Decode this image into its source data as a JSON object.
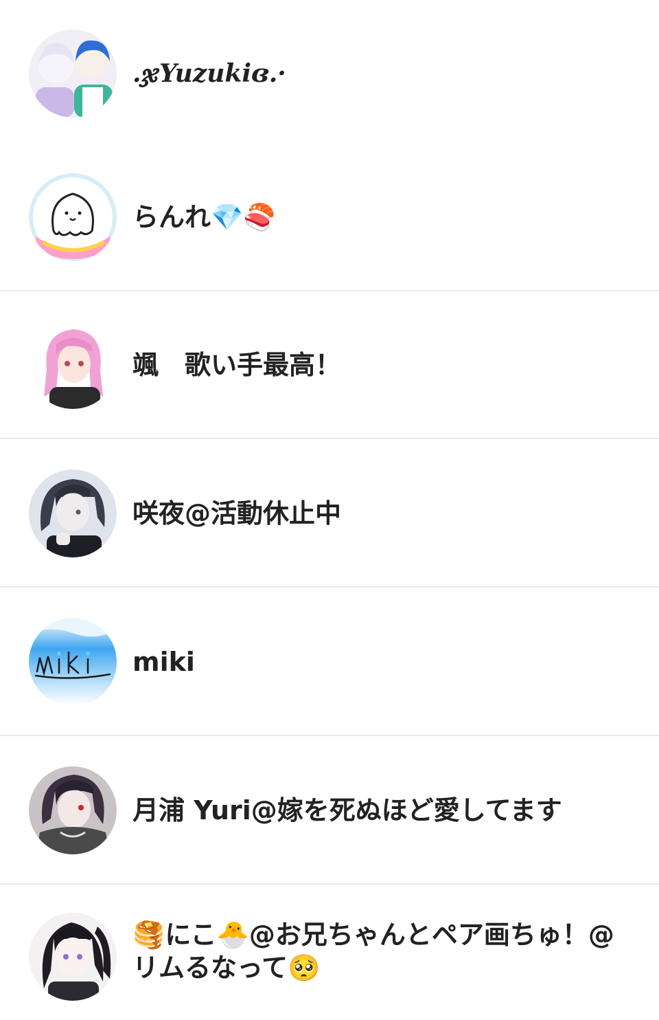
{
  "users": [
    {
      "name": ".ჯYuzukiɞ.·",
      "avatar_icon": "anime-boys-avatar-icon",
      "style": "script"
    },
    {
      "name": "らんれ💎🍣",
      "avatar_icon": "ghost-sticker-avatar-icon",
      "style": "normal"
    },
    {
      "name": "颯　歌い手最高！",
      "avatar_icon": "pink-hair-girl-avatar-icon",
      "style": "normal"
    },
    {
      "name": "咲夜@活動休止中",
      "avatar_icon": "dark-hair-boy-avatar-icon",
      "style": "normal"
    },
    {
      "name": "miki",
      "avatar_icon": "miki-logo-avatar-icon",
      "style": "normal"
    },
    {
      "name": "月浦 Yuri@嫁を死ぬほど愛してます",
      "avatar_icon": "red-eye-boy-avatar-icon",
      "style": "normal"
    },
    {
      "name": "🥞にこ🐣@お兄ちゃんとペア画ちゅ！@リムるなって🥺",
      "avatar_icon": "twin-tail-girl-avatar-icon",
      "style": "normal"
    }
  ]
}
